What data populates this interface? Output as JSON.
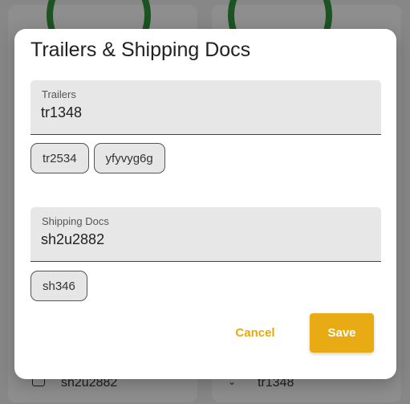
{
  "background": {
    "left_card_text": "sh2u2882",
    "right_card_text": "tr1348"
  },
  "dialog": {
    "title": "Trailers & Shipping Docs",
    "trailers": {
      "label": "Trailers",
      "value": "tr1348",
      "chips": [
        "tr2534",
        "yfyvyg6g"
      ]
    },
    "shipping_docs": {
      "label": "Shipping Docs",
      "value": "sh2u2882",
      "chips": [
        "sh346"
      ]
    },
    "cancel_label": "Cancel",
    "save_label": "Save"
  },
  "colors": {
    "accent": "#e8ab14",
    "ring": "#2f8f3b"
  }
}
